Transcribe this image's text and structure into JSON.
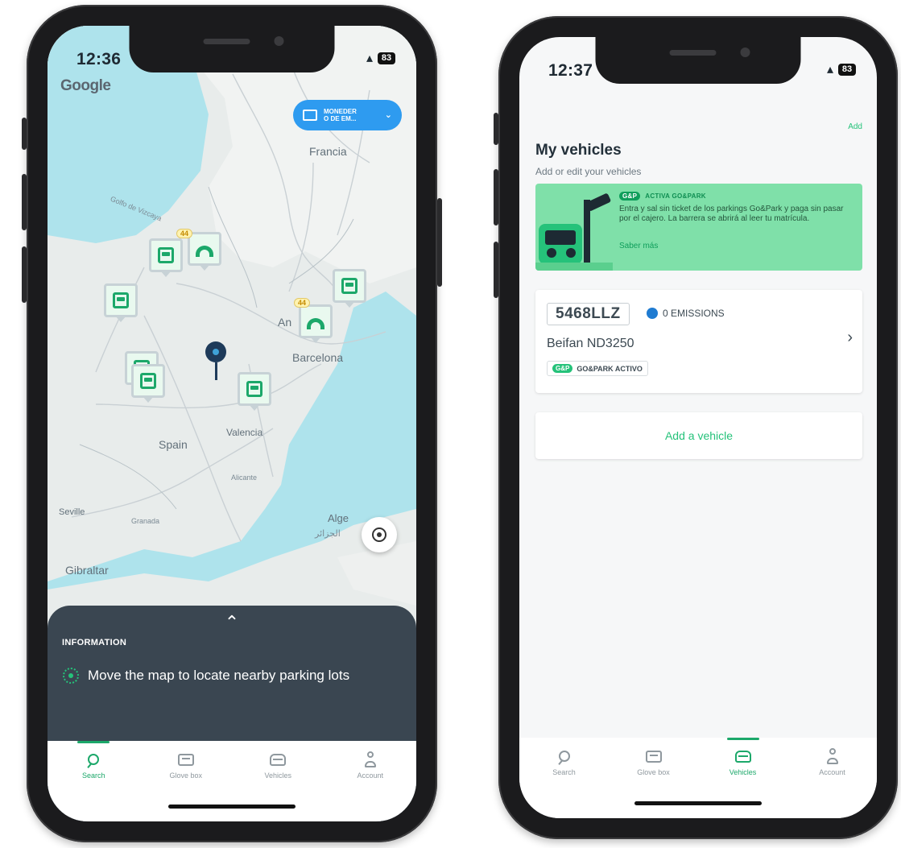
{
  "map_phone": {
    "status_time": "12:36",
    "battery": "83",
    "map_logo": "Google",
    "filter_chip": {
      "line1": "MONEDER",
      "line2": "O DE EM..."
    },
    "labels": {
      "france": "Francia",
      "gulf": "Golfo de Vizcaya",
      "barcelona": "Barcelona",
      "andorra": "An",
      "spain": "Spain",
      "valencia": "Valencia",
      "alicante": "Alicante",
      "seville": "Seville",
      "granada": "Granada",
      "gibraltar": "Gibraltar",
      "algiers": "Alge",
      "algiers_ar": "الجزائر"
    },
    "marker_badges": [
      "44",
      "44"
    ],
    "info": {
      "title": "INFORMATION",
      "message": "Move the map to locate nearby parking lots"
    },
    "tabs": [
      {
        "label": "Search",
        "icon": "search-icon"
      },
      {
        "label": "Glove box",
        "icon": "glove-box-icon"
      },
      {
        "label": "Vehicles",
        "icon": "car-icon"
      },
      {
        "label": "Account",
        "icon": "user-icon"
      }
    ],
    "active_tab": "Search"
  },
  "vehicles_phone": {
    "status_time": "12:37",
    "battery": "83",
    "header_action": "Add",
    "title": "My vehicles",
    "subtitle": "Add or edit your vehicles",
    "promo": {
      "badge": "G&P",
      "tag": "ACTIVA GO&PARK",
      "text": "Entra y sal sin ticket de los parkings Go&Park y paga sin pasar por el cajero. La barrera se abrirá al leer tu matrícula.",
      "link": "Saber más"
    },
    "vehicle": {
      "plate": "5468LLZ",
      "emissions": "0 EMISSIONS",
      "model": "Beifan ND3250",
      "status_badge": "G&P",
      "status": "GO&PARK ACTIVO"
    },
    "add_vehicle": "Add a vehicle",
    "tabs": [
      {
        "label": "Search",
        "icon": "search-icon"
      },
      {
        "label": "Glove box",
        "icon": "glove-box-icon"
      },
      {
        "label": "Vehicles",
        "icon": "car-icon"
      },
      {
        "label": "Account",
        "icon": "user-icon"
      }
    ],
    "active_tab": "Vehicles"
  },
  "colors": {
    "brand_green": "#1ca86a",
    "promo_green": "#7fe0a9",
    "filter_blue": "#2e9bf0",
    "sheet_dark": "#3a4651",
    "emissions_blue": "#1f7bd1"
  }
}
